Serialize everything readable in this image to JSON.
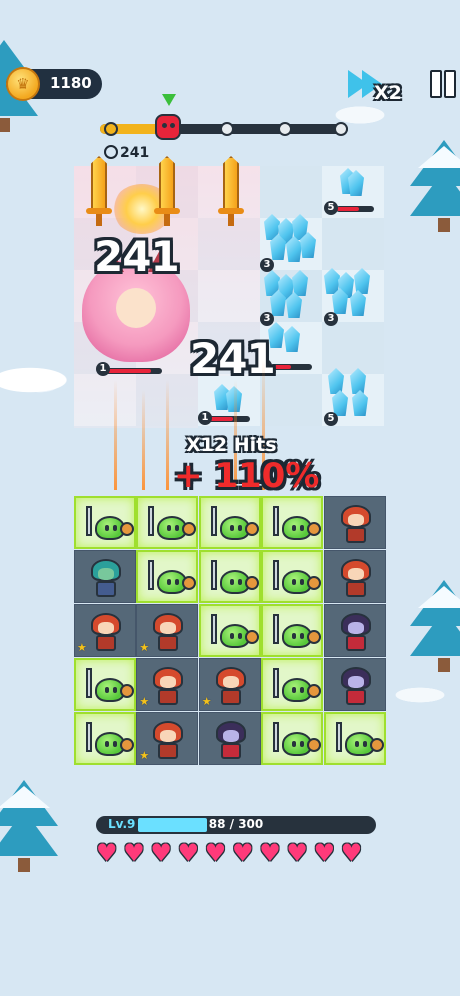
{
  "hud": {
    "coins": "1180",
    "speed_multiplier": "X2",
    "colors": {
      "coin": "#f3a81f",
      "accent": "#3fc2ea"
    }
  },
  "wave": {
    "progress": 0.28,
    "checkpoints": 5,
    "boss_hp_label": "241"
  },
  "combat": {
    "damage_popup_1": "241",
    "damage_popup_2": "241",
    "hits_text": "X12 Hits",
    "bonus_text": "+ 110%"
  },
  "enemies": [
    {
      "type": "boss",
      "level": "1",
      "hp_fraction": 0.8
    },
    {
      "type": "crystal",
      "level": "5",
      "hp_fraction": 0.6
    },
    {
      "type": "crystal",
      "level": "3",
      "hp_fraction": 1.0
    },
    {
      "type": "crystal",
      "level": "3",
      "hp_fraction": 1.0
    },
    {
      "type": "crystal",
      "level": "3",
      "hp_fraction": 1.0
    },
    {
      "type": "crystal",
      "level": "1",
      "hp_fraction": 0.5
    },
    {
      "type": "crystal",
      "level": "1",
      "hp_fraction": 0.6
    },
    {
      "type": "crystal",
      "level": "5",
      "hp_fraction": 1.0
    }
  ],
  "grid": [
    [
      "slime",
      "slime",
      "slime",
      "slime",
      "warrior"
    ],
    [
      "goblin",
      "slime",
      "slime",
      "slime",
      "warrior"
    ],
    [
      "warrior",
      "warrior",
      "slime",
      "slime",
      "vampire"
    ],
    [
      "slime",
      "warrior",
      "warrior",
      "slime",
      "vampire"
    ],
    [
      "slime",
      "warrior",
      "vampire",
      "slime",
      "slime"
    ]
  ],
  "player": {
    "level_label": "Lv.9",
    "xp_text": "88 / 300",
    "xp_fraction": 0.293,
    "hearts": 10
  }
}
